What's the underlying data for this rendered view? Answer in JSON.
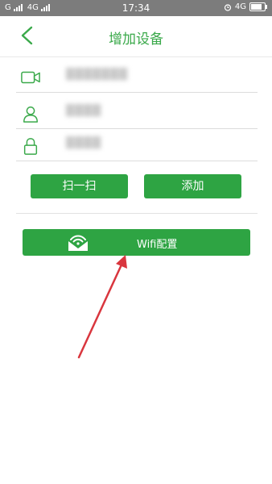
{
  "status_bar": {
    "carrier1": "G",
    "carrier2": "4G",
    "time": "17:34",
    "network_right": "4G",
    "battery_level": 0.8
  },
  "header": {
    "title": "增加设备"
  },
  "form": {
    "device_id_value": "███████",
    "username_value": "████",
    "password_value": "████"
  },
  "buttons": {
    "scan_label": "扫一扫",
    "add_label": "添加",
    "wifi_config_label": "Wifi配置"
  },
  "colors": {
    "accent": "#2ea443",
    "title": "#3aa94a",
    "annotation_arrow": "#d9363e"
  }
}
